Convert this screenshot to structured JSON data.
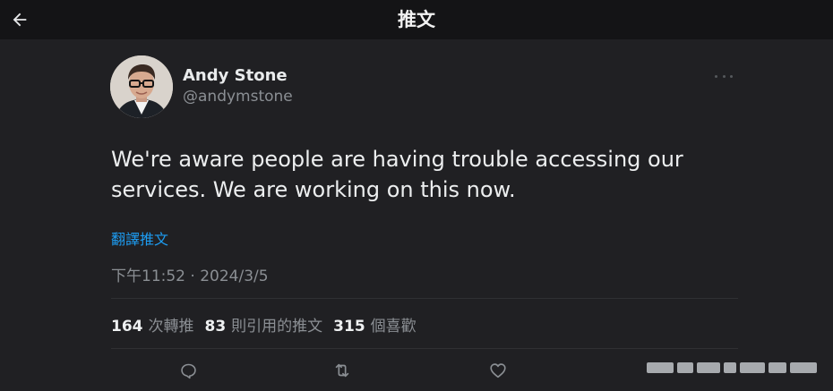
{
  "header": {
    "title": "推文",
    "back_icon": "arrow-left-icon"
  },
  "tweet": {
    "author": {
      "name": "Andy Stone",
      "handle": "@andymstone"
    },
    "text": "We're aware people are having trouble accessing our services. We are working on this now.",
    "translate_label": "翻譯推文",
    "timestamp": "下午11:52 · 2024/3/5",
    "stats": [
      {
        "count": "164",
        "label": "次轉推"
      },
      {
        "count": "83",
        "label": "則引用的推文"
      },
      {
        "count": "315",
        "label": "個喜歡"
      }
    ],
    "actions": [
      "reply-icon",
      "retweet-icon",
      "like-icon"
    ]
  },
  "colors": {
    "background": "#202023",
    "header_background": "#141416",
    "link": "#1d9bf0",
    "secondary_text": "#8b8f94"
  }
}
